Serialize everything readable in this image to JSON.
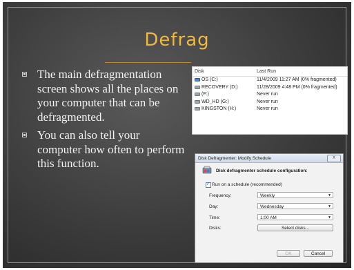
{
  "slide": {
    "title": "Defrag",
    "bullets": [
      "The main defragmentation screen shows all the places on your computer that can be defragmented.",
      "You can also tell your computer how often to perform this function."
    ]
  },
  "disk_list": {
    "columns": [
      "Disk",
      "Last Run"
    ],
    "rows": [
      {
        "icon": "os-drive-icon",
        "disk": "OS (C:)",
        "last_run": "11/4/2009 11:27 AM (0% fragmented)"
      },
      {
        "icon": "drive-icon",
        "disk": "RECOVERY (D:)",
        "last_run": "11/28/2009 4:48 PM (0% fragmented)"
      },
      {
        "icon": "drive-icon",
        "disk": "(F:)",
        "last_run": "Never run"
      },
      {
        "icon": "drive-icon",
        "disk": "WD_HD (G:)",
        "last_run": "Never run"
      },
      {
        "icon": "drive-icon",
        "disk": "KINGSTON (H:)",
        "last_run": "Never run"
      }
    ]
  },
  "schedule_dialog": {
    "title": "Disk Defragmenter: Modify Schedule",
    "close_label": "X",
    "heading": "Disk defragmenter schedule configuration:",
    "run_on_schedule_label": "Run on a schedule (recommended)",
    "frequency_label": "Frequency:",
    "frequency_value": "Weekly",
    "day_label": "Day:",
    "day_value": "Wednesday",
    "time_label": "Time:",
    "time_value": "1:00 AM",
    "disks_label": "Disks:",
    "select_disks_label": "Select disks...",
    "ok_label": "OK",
    "cancel_label": "Cancel"
  },
  "colors": {
    "title": "#f0b840",
    "background": "#3c3c3c",
    "text": "#f2f2f2"
  }
}
